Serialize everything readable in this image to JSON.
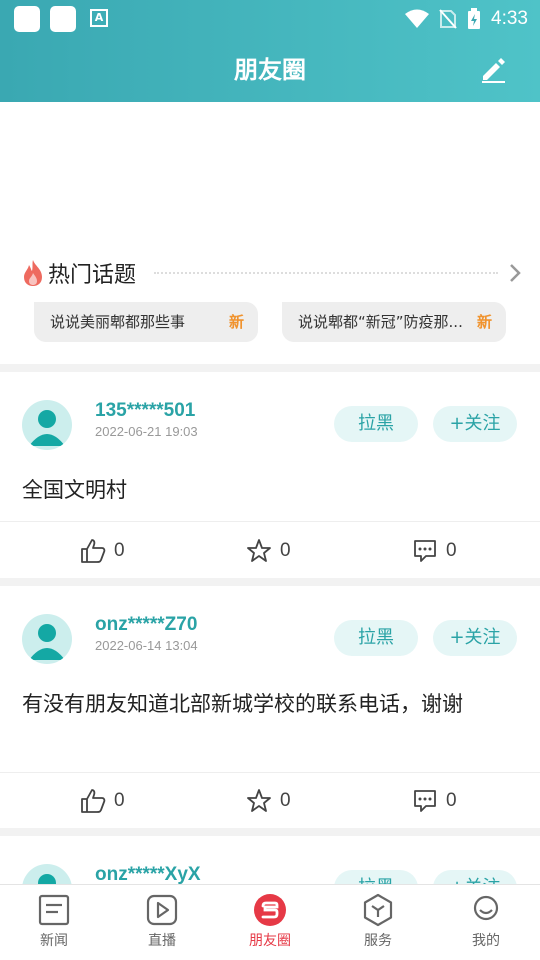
{
  "status_bar": {
    "time": "4:33"
  },
  "header": {
    "title": "朋友圈"
  },
  "hot_topics": {
    "title": "热门话题",
    "chips": [
      {
        "text": "说说美丽郫都那些事",
        "badge": "新"
      },
      {
        "text": "说说郫都“新冠”防疫那...",
        "badge": "新"
      }
    ]
  },
  "posts": [
    {
      "username": "135*****501",
      "date": "2022-06-21 19:03",
      "block_label": "拉黑",
      "follow_label": "+关注",
      "content": "全国文明村",
      "likes": "0",
      "favorites": "0",
      "comments": "0"
    },
    {
      "username": "onz*****Z70",
      "date": "2022-06-14 13:04",
      "block_label": "拉黑",
      "follow_label": "+关注",
      "content": "有没有朋友知道北部新城学校的联系电话，谢谢",
      "likes": "0",
      "favorites": "0",
      "comments": "0"
    },
    {
      "username": "onz*****XyX",
      "block_label": "拉黑",
      "follow_label": "+关注"
    }
  ],
  "bottom_nav": {
    "items": [
      {
        "label": "新闻",
        "icon": "news-icon"
      },
      {
        "label": "直播",
        "icon": "live-icon"
      },
      {
        "label": "朋友圈",
        "icon": "moments-icon"
      },
      {
        "label": "服务",
        "icon": "service-icon"
      },
      {
        "label": "我的",
        "icon": "profile-icon"
      }
    ],
    "active_index": 2
  },
  "colors": {
    "header_start": "#3aa8b2",
    "header_end": "#4fc3c8",
    "accent": "#2aa3a6",
    "new_badge": "#f0932e",
    "nav_active": "#e63946"
  }
}
